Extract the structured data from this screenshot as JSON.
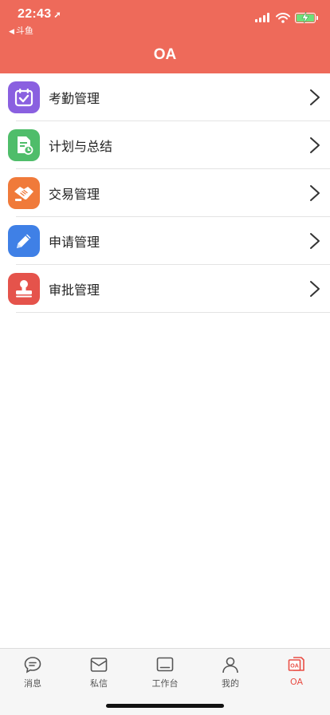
{
  "status_bar": {
    "time": "22:43",
    "back_app": "斗鱼"
  },
  "header": {
    "title": "OA",
    "bg_color": "#ee6a5a"
  },
  "menu_items": [
    {
      "label": "考勤管理",
      "icon": "calendar-check-icon",
      "color": "#8a60e0"
    },
    {
      "label": "计划与总结",
      "icon": "document-clock-icon",
      "color": "#4fbd6a"
    },
    {
      "label": "交易管理",
      "icon": "handshake-icon",
      "color": "#f07a3a"
    },
    {
      "label": "申请管理",
      "icon": "pencil-icon",
      "color": "#3f80e6"
    },
    {
      "label": "审批管理",
      "icon": "stamp-icon",
      "color": "#e5534b"
    }
  ],
  "tabbar": {
    "items": [
      {
        "label": "消息",
        "icon": "chat-bubble-icon"
      },
      {
        "label": "私信",
        "icon": "envelope-icon"
      },
      {
        "label": "工作台",
        "icon": "monitor-icon"
      },
      {
        "label": "我的",
        "icon": "person-icon"
      },
      {
        "label": "OA",
        "icon": "oa-doc-icon",
        "active": true
      }
    ],
    "active_color": "#e94e45"
  }
}
